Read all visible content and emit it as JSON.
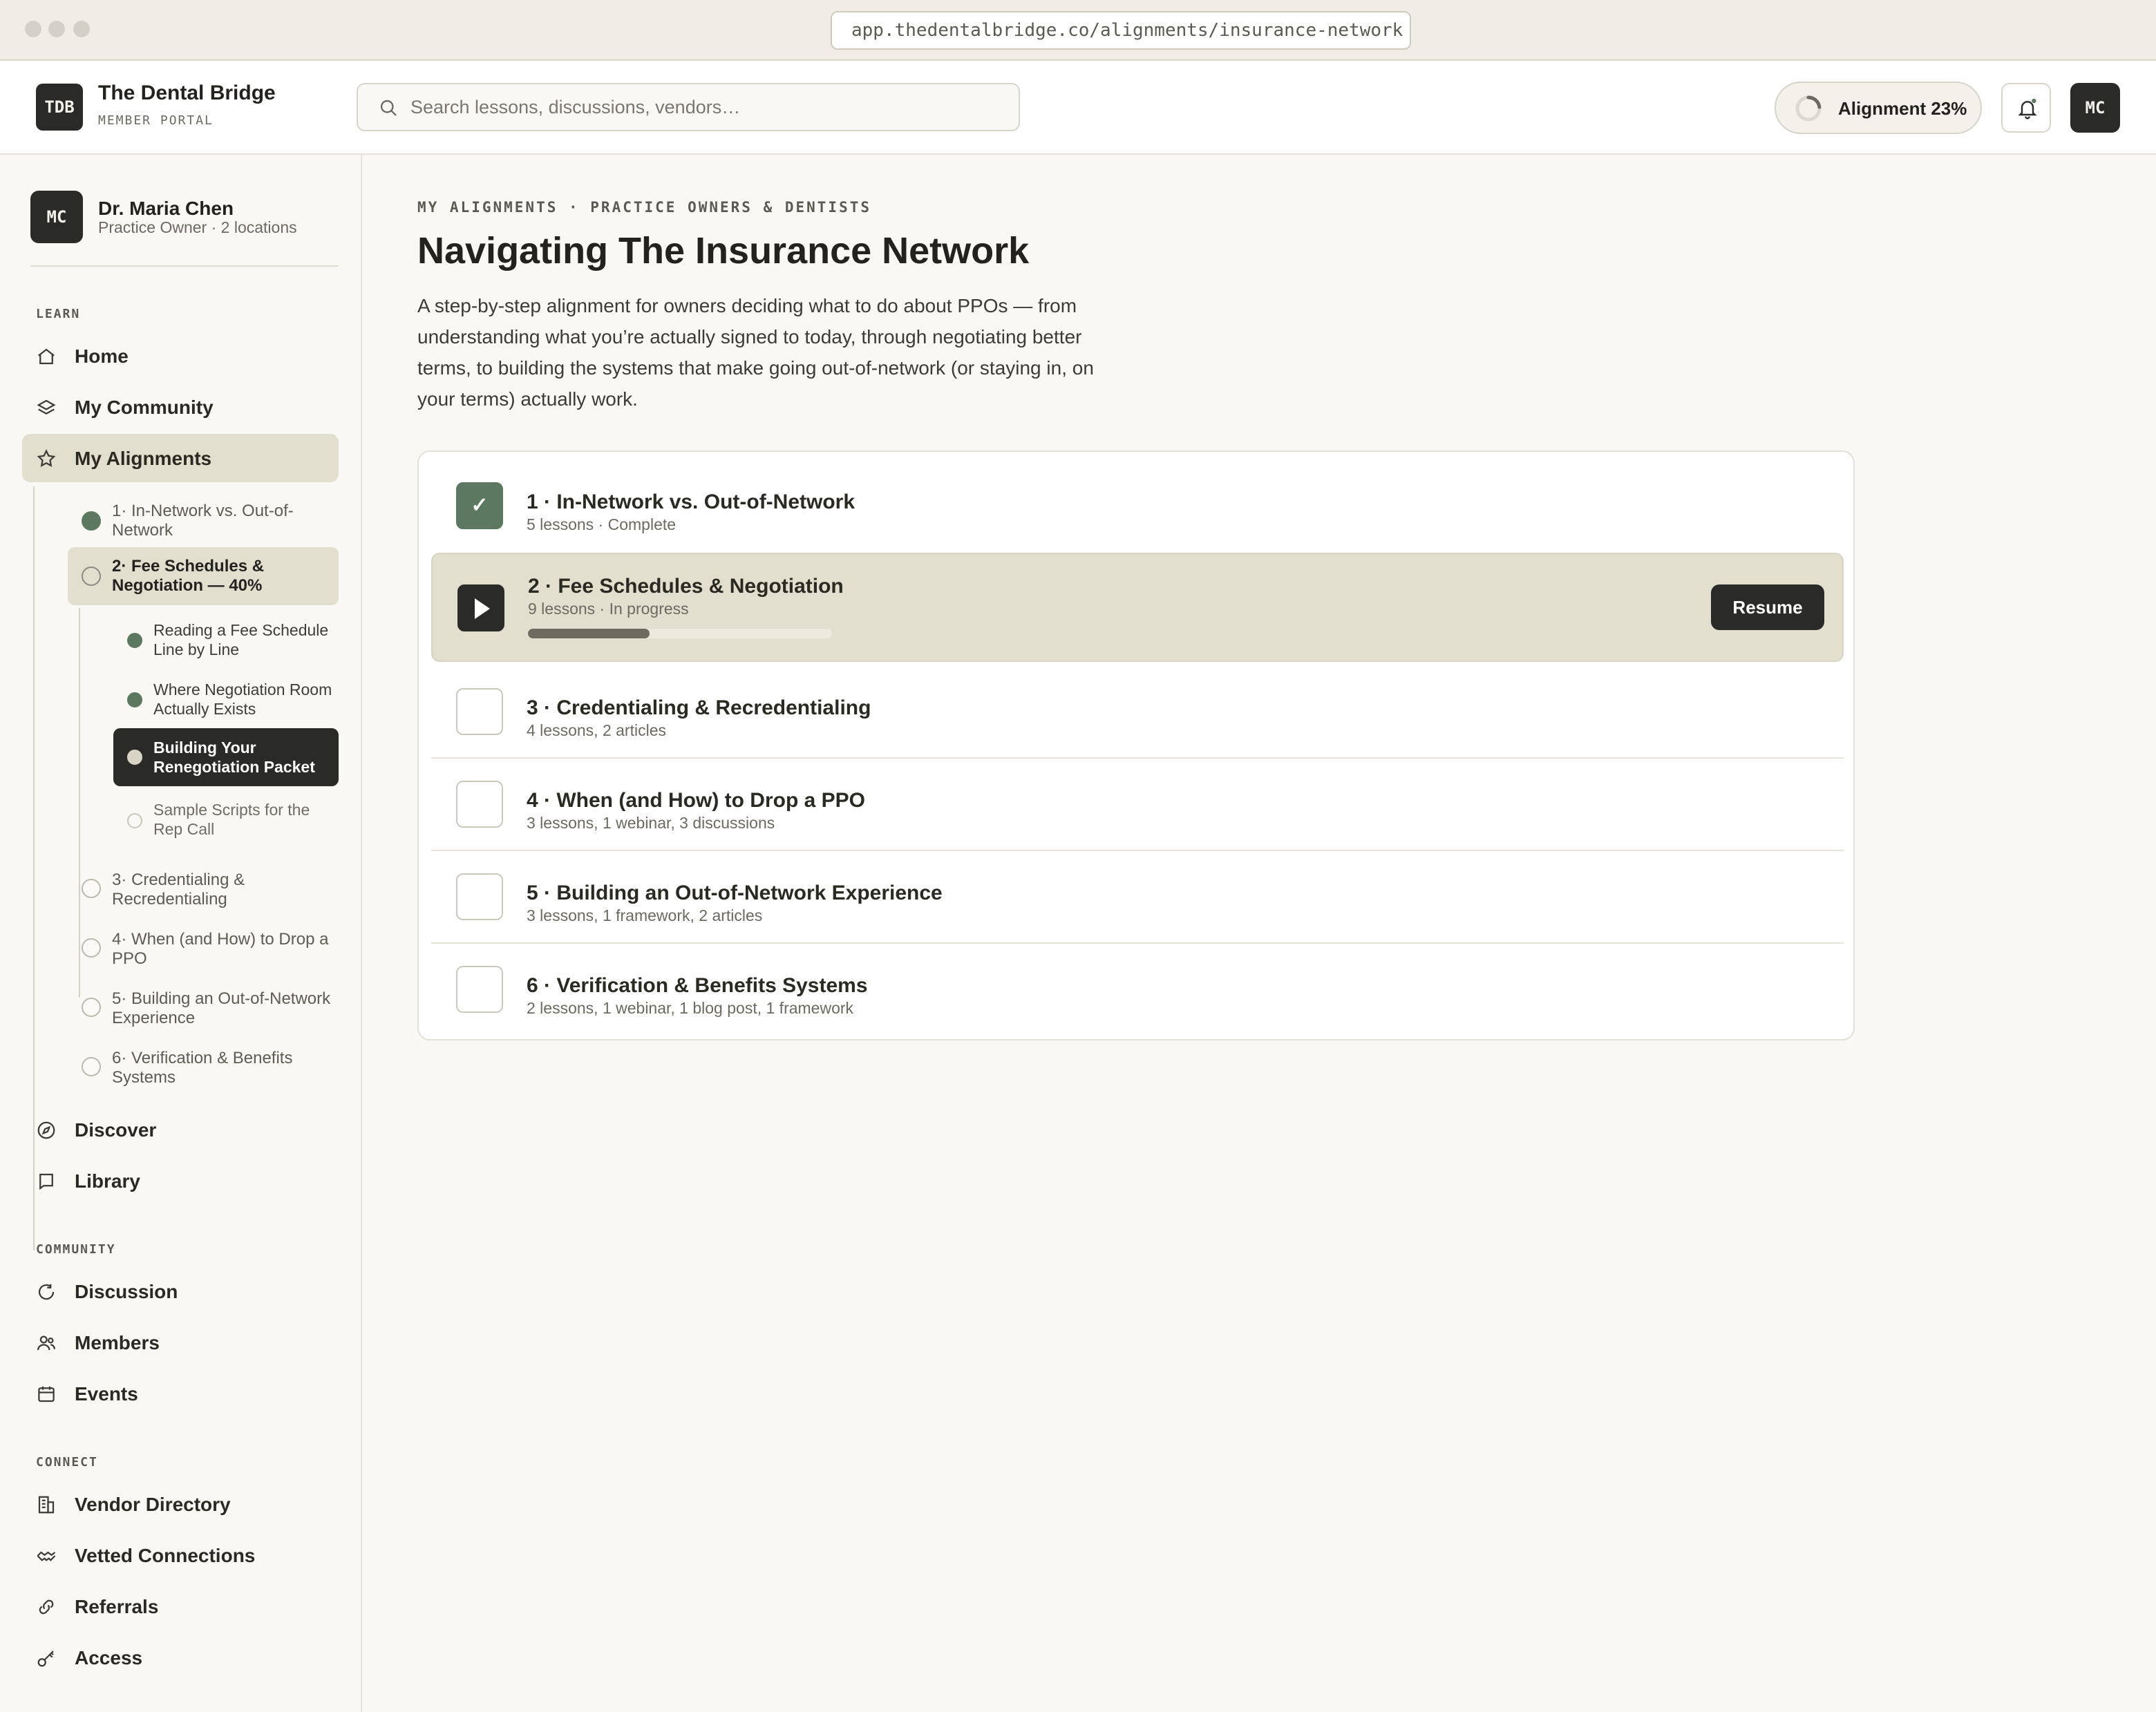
{
  "browser": {
    "url": "app.thedentalbridge.co/alignments/insurance-network"
  },
  "header": {
    "logo_text": "TDB",
    "brand_name": "The Dental Bridge",
    "brand_sub": "MEMBER PORTAL",
    "search_placeholder": "Search lessons, discussions, vendors…",
    "alignment_label": "Alignment 23%",
    "alignment_progress": 0.23,
    "avatar_initials": "MC"
  },
  "sidebar": {
    "user": {
      "initials": "MC",
      "name": "Dr. Maria Chen",
      "role": "Practice Owner · 2 locations"
    },
    "learn_label": "LEARN",
    "learn_items": [
      {
        "label": "Home",
        "icon": "home-icon"
      },
      {
        "label": "My Community",
        "icon": "layers-icon"
      },
      {
        "label": "My Alignments",
        "icon": "star-icon",
        "active": true
      }
    ],
    "alignments": [
      {
        "label": "1· In-Network vs. Out-of-Network",
        "status": "complete"
      },
      {
        "label": "2· Fee Schedules & Negotiation — 40%",
        "status": "current"
      },
      {
        "label": "3· Credentialing & Recredentialing",
        "status": "todo"
      },
      {
        "label": "4· When (and How) to Drop a PPO",
        "status": "todo"
      },
      {
        "label": "5· Building an Out-of-Network Experience",
        "status": "todo"
      },
      {
        "label": "6· Verification & Benefits Systems",
        "status": "todo"
      }
    ],
    "lessons": [
      {
        "label": "Reading a Fee Schedule Line by Line",
        "status": "complete"
      },
      {
        "label": "Where Negotiation Room Actually Exists",
        "status": "complete"
      },
      {
        "label": "Building Your Renegotiation Packet",
        "status": "current"
      },
      {
        "label": "Sample Scripts for the Rep Call",
        "status": "todo"
      }
    ],
    "more_items": [
      {
        "label": "Discover",
        "icon": "compass-icon"
      },
      {
        "label": "Library",
        "icon": "book-icon"
      }
    ],
    "community_label": "COMMUNITY",
    "community_items": [
      {
        "label": "Discussion",
        "icon": "refresh-icon"
      },
      {
        "label": "Members",
        "icon": "users-icon"
      },
      {
        "label": "Events",
        "icon": "calendar-icon"
      }
    ],
    "connect_label": "CONNECT",
    "connect_items": [
      {
        "label": "Vendor Directory",
        "icon": "building-icon"
      },
      {
        "label": "Vetted Connections",
        "icon": "handshake-icon"
      },
      {
        "label": "Referrals",
        "icon": "link-icon"
      },
      {
        "label": "Access",
        "icon": "key-icon"
      }
    ]
  },
  "main": {
    "eyebrow": "MY ALIGNMENTS · PRACTICE OWNERS & DENTISTS",
    "title": "Navigating The Insurance Network",
    "description": "A step-by-step alignment for owners deciding what to do about PPOs — from understanding what you’re actually signed to today, through negotiating better terms, to building the systems that make going out-of-network (or staying in, on your terms) actually work.",
    "modules": [
      {
        "title": "1 · In-Network vs. Out-of-Network",
        "subtitle": "5 lessons · Complete",
        "status": "complete"
      },
      {
        "title": "2 · Fee Schedules & Negotiation",
        "subtitle": "9 lessons · In progress",
        "status": "current",
        "progress": 0.4,
        "action": "Resume"
      },
      {
        "title": "3 · Credentialing & Recredentialing",
        "subtitle": "4 lessons, 2 articles",
        "status": "todo"
      },
      {
        "title": "4 · When (and How) to Drop a PPO",
        "subtitle": "3 lessons, 1 webinar, 3 discussions",
        "status": "todo"
      },
      {
        "title": "5 · Building an Out-of-Network Experience",
        "subtitle": "3 lessons, 1 framework, 2 articles",
        "status": "todo"
      },
      {
        "title": "6 · Verification & Benefits Systems",
        "subtitle": "2 lessons, 1 webinar, 1 blog post, 1 framework",
        "status": "todo"
      }
    ],
    "checkmark": "✓"
  },
  "colors": {
    "accent_green": "#5d7860",
    "dark": "#2a2a28",
    "active_bg": "#e2dfcf"
  }
}
